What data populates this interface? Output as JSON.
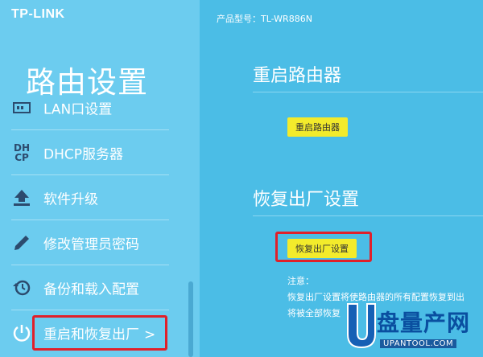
{
  "brand": {
    "logo": "TP-LINK"
  },
  "sidebar": {
    "title": "路由设置",
    "items": [
      {
        "label": "LAN口设置",
        "icon": "lan-icon"
      },
      {
        "label": "DHCP服务器",
        "icon": "dhcp-icon",
        "icon_text_top": "DH",
        "icon_text_bottom": "CP"
      },
      {
        "label": "软件升级",
        "icon": "upload-icon"
      },
      {
        "label": "修改管理员密码",
        "icon": "pencil-icon"
      },
      {
        "label": "备份和载入配置",
        "icon": "history-icon"
      },
      {
        "label": "重启和恢复出厂",
        "icon": "power-icon",
        "chevron": ">"
      }
    ]
  },
  "main": {
    "model_label": "产品型号：TL-WR886N",
    "reboot": {
      "title": "重启路由器",
      "button": "重启路由器"
    },
    "factory_reset": {
      "title": "恢复出厂设置",
      "button": "恢复出厂设置"
    },
    "note": {
      "title": "注意：",
      "line1": "恢复出厂设置将使路由器的所有配置恢复到出",
      "line2": "将被全部恢复"
    }
  },
  "watermark": {
    "text": "盘量产网",
    "url": "UPANTOOL.COM"
  },
  "colors": {
    "main_bg": "#4bbde6",
    "sidebar_bg": "#6cccef",
    "button_yellow": "#f3eb2b",
    "highlight_red": "#e0202a",
    "icon_dark": "#2c4b6e"
  }
}
